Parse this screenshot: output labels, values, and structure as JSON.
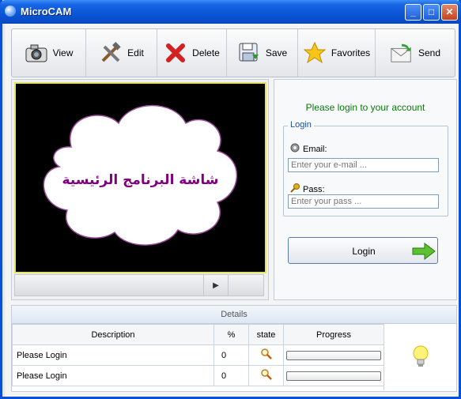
{
  "window": {
    "title": "MicroCAM",
    "controls": {
      "minimize": "_",
      "maximize": "□",
      "close": "✕"
    }
  },
  "toolbar": {
    "buttons": [
      {
        "label": "View",
        "icon": "camera-icon"
      },
      {
        "label": "Edit",
        "icon": "tools-icon"
      },
      {
        "label": "Delete",
        "icon": "delete-x-icon"
      },
      {
        "label": "Save",
        "icon": "save-icon"
      },
      {
        "label": "Favorites",
        "icon": "star-icon"
      },
      {
        "label": "Send",
        "icon": "mail-icon"
      }
    ]
  },
  "viewer": {
    "cloud_text": "شاشة البرنامج الرئيسية",
    "scroll_arrow": "▶"
  },
  "login": {
    "message": "Please login to your account",
    "group_title": "Login",
    "email_label": "Email:",
    "email_placeholder": "Enter your e-mail ...",
    "pass_label": "Pass:",
    "pass_placeholder": "Enter your pass ...",
    "button_label": "Login"
  },
  "details": {
    "title": "Details",
    "columns": [
      "Description",
      "%",
      "state",
      "Progress"
    ],
    "rows": [
      {
        "description": "Please Login",
        "percent": "0",
        "state_icon": "magnifier-icon",
        "progress": 0
      },
      {
        "description": "Please Login",
        "percent": "0",
        "state_icon": "magnifier-icon",
        "progress": 0
      }
    ],
    "side_icon": "lightbulb-icon"
  },
  "colors": {
    "titlebar": "#0a55d6",
    "login_message": "#0a7a0a",
    "cloud_text": "#800080",
    "video_border": "#e5e26a"
  }
}
